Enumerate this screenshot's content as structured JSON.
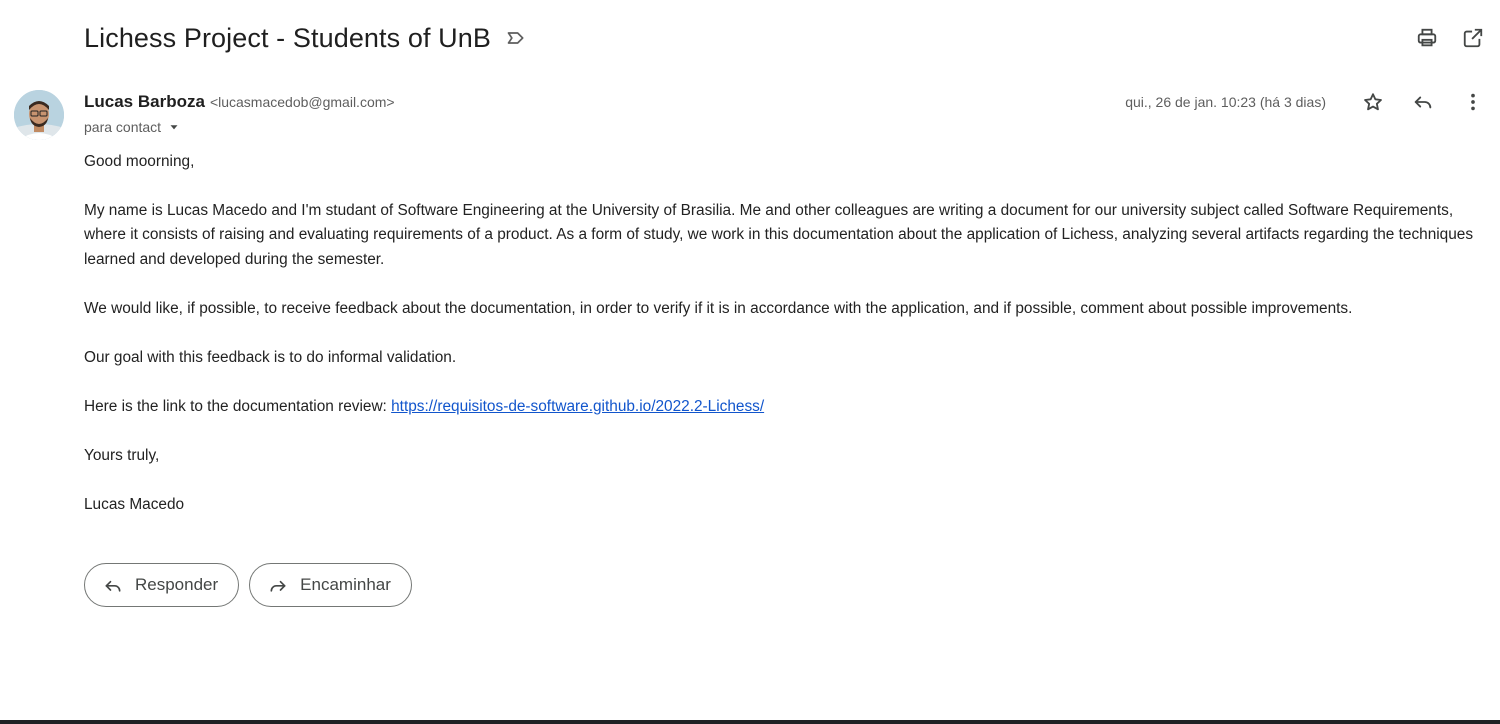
{
  "email": {
    "subject": "Lichess Project - Students of UnB",
    "sender": {
      "name": "Lucas Barboza",
      "email": "<lucasmacedob@gmail.com>"
    },
    "date": "qui., 26 de jan. 10:23 (há 3 dias)",
    "to": "para contact",
    "body": {
      "greeting": "Good moorning,",
      "paragraph1": "My name is Lucas Macedo and I'm studant of Software Engineering at the University of Brasilia. Me and other colleagues are writing a document for our university subject called Software Requirements, where it consists of raising and evaluating requirements of a product. As a form of study, we work in this documentation about the application of Lichess, analyzing several artifacts regarding the techniques learned and developed during the semester.",
      "paragraph2": "We would like, if possible, to receive  feedback about the documentation, in order to verify if it is in accordance with the application, and if possible, comment about possible improvements.",
      "paragraph3": "Our goal with this feedback is to do informal validation.",
      "link_intro": "Here is the link to the documentation review: ",
      "link": "https://requisitos-de-software.github.io/2022.2-Lichess/",
      "closing": "Yours truly,",
      "signature": "Lucas Macedo"
    }
  },
  "actions": {
    "reply_label": "Responder",
    "forward_label": "Encaminhar"
  },
  "icons": {
    "label": "label-outline-icon",
    "print": "print-icon",
    "open_new_window": "open-in-new-icon",
    "star": "star-outline-icon",
    "reply": "reply-icon",
    "more": "more-vert-icon",
    "caret": "caret-down-icon",
    "forward": "forward-icon"
  },
  "colors": {
    "link": "#1155cc",
    "text": "#222222",
    "muted": "#5e5e5e",
    "border": "#747775"
  }
}
